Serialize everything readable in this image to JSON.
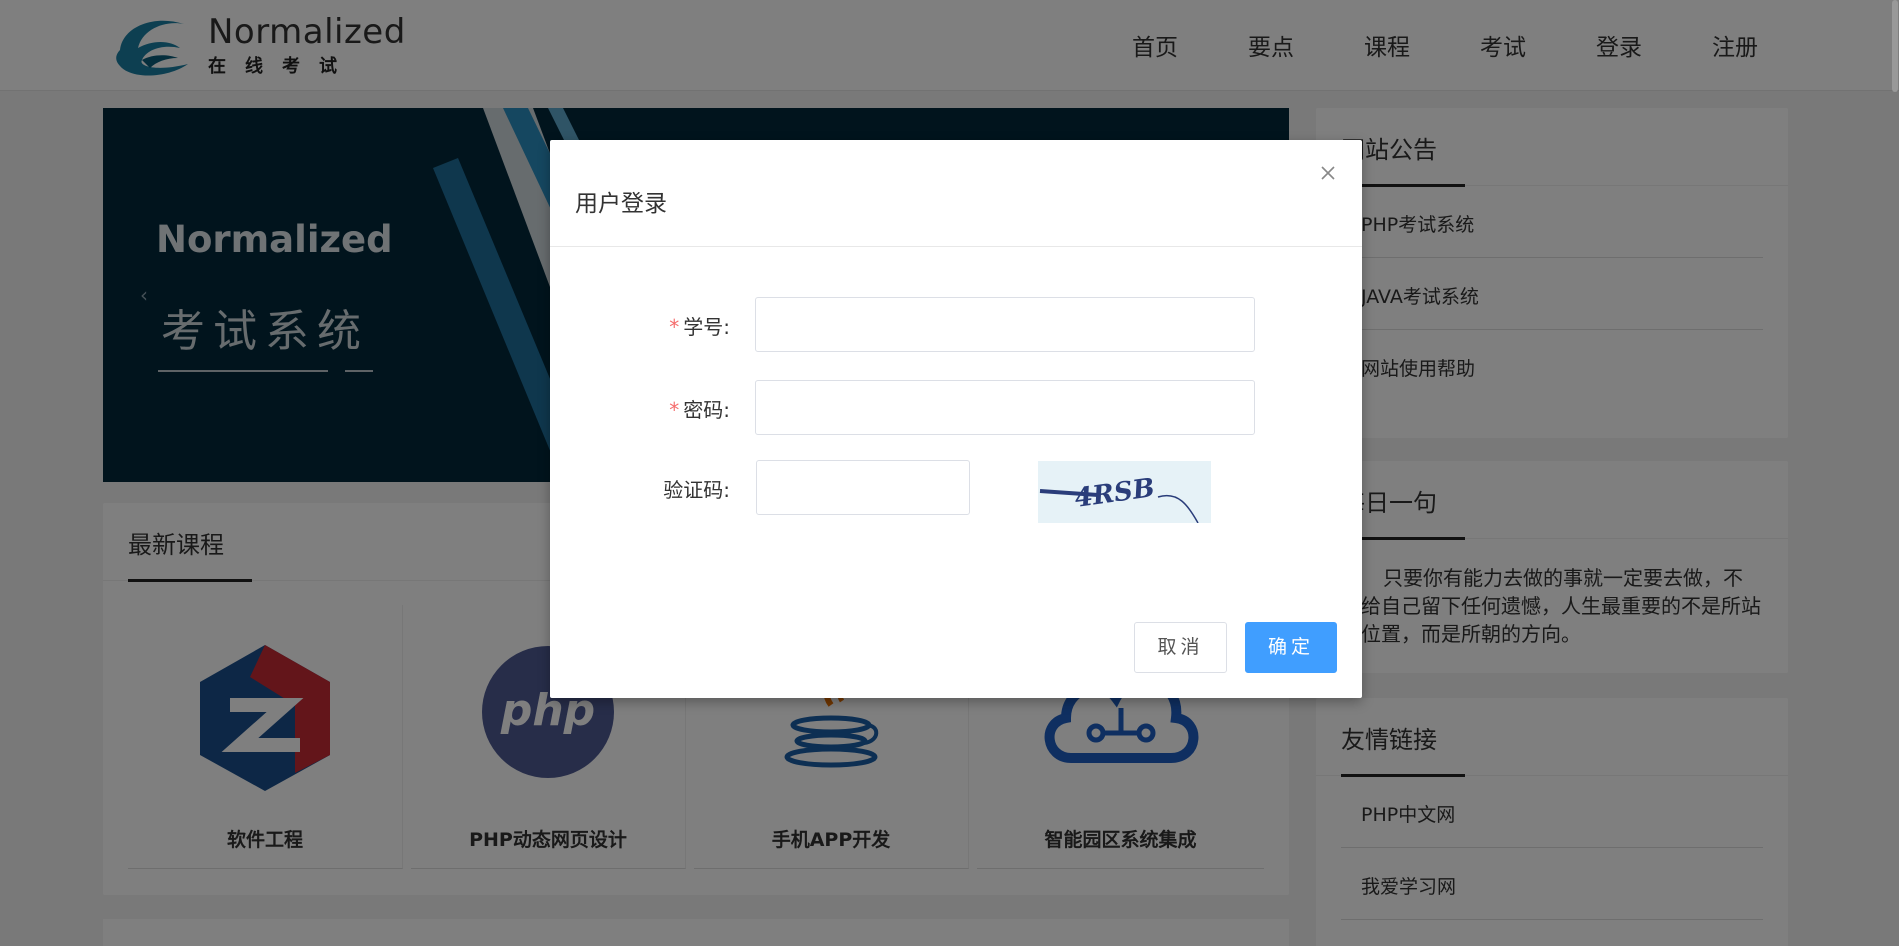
{
  "brand": {
    "title": "Normalized",
    "subtitle": "在线考试"
  },
  "nav": {
    "items": [
      {
        "label": "首页"
      },
      {
        "label": "要点"
      },
      {
        "label": "课程"
      },
      {
        "label": "考试"
      },
      {
        "label": "登录"
      },
      {
        "label": "注册"
      }
    ]
  },
  "banner": {
    "title": "Normalized",
    "subtitle": "考试系统"
  },
  "courses": {
    "title": "最新课程",
    "items": [
      {
        "name": "软件工程",
        "icon": "software-engineering-icon"
      },
      {
        "name": "PHP动态网页设计",
        "icon": "php-icon"
      },
      {
        "name": "手机APP开发",
        "icon": "java-icon"
      },
      {
        "name": "智能园区系统集成",
        "icon": "cloud-network-icon"
      }
    ]
  },
  "notice": {
    "title": "网站公告",
    "items": [
      {
        "label": "PHP考试系统"
      },
      {
        "label": "JAVA考试系统"
      },
      {
        "label": "网站使用帮助"
      }
    ]
  },
  "daily": {
    "title": "每日一句",
    "quote": "只要你有能力去做的事就一定要去做，不要给自己留下任何遗憾，人生最重要的不是所站的位置，而是所朝的方向。"
  },
  "links": {
    "title": "友情链接",
    "items": [
      {
        "label": "PHP中文网"
      },
      {
        "label": "我爱学习网"
      }
    ]
  },
  "modal": {
    "title": "用户登录",
    "fields": {
      "student_id": {
        "label": "学号:",
        "required": true,
        "value": ""
      },
      "password": {
        "label": "密码:",
        "required": true,
        "value": ""
      },
      "captcha": {
        "label": "验证码:",
        "required": false,
        "value": "",
        "image_text": "4RSB"
      }
    },
    "cancel_label": "取消",
    "ok_label": "确定"
  },
  "colors": {
    "primary": "#409eff",
    "required": "#f56c6c",
    "banner_bg": "#03283b",
    "overlay": "rgba(0,0,0,0.5)"
  }
}
